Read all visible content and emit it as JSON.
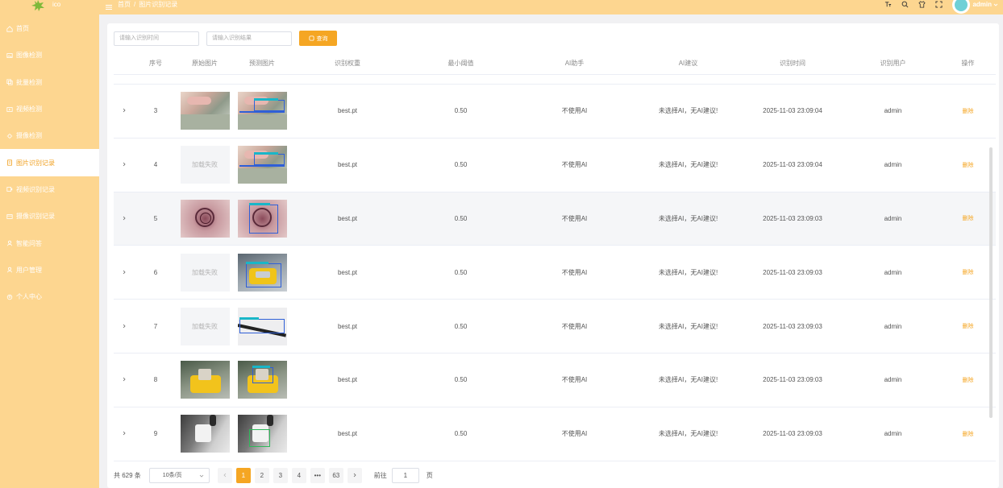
{
  "app": {
    "logo_text": "ico"
  },
  "sidebar": {
    "items": [
      {
        "label": "首页",
        "icon": "home-icon",
        "active": false
      },
      {
        "label": "图像检测",
        "icon": "image-icon",
        "active": false
      },
      {
        "label": "批量检测",
        "icon": "batch-icon",
        "active": false
      },
      {
        "label": "视频检测",
        "icon": "video-icon",
        "active": false
      },
      {
        "label": "摄像检测",
        "icon": "camera-icon",
        "active": false
      },
      {
        "label": "图片识别记录",
        "icon": "record-icon",
        "active": true
      },
      {
        "label": "视频识别记录",
        "icon": "video-record-icon",
        "active": false
      },
      {
        "label": "摄像识别记录",
        "icon": "camera-record-icon",
        "active": false
      },
      {
        "label": "智能问答",
        "icon": "chat-icon",
        "active": false
      },
      {
        "label": "用户管理",
        "icon": "user-manage-icon",
        "active": false
      },
      {
        "label": "个人中心",
        "icon": "profile-icon",
        "active": false
      }
    ]
  },
  "topbar": {
    "breadcrumb": [
      "首页",
      "/",
      "图片识别记录"
    ],
    "username": "admin"
  },
  "search": {
    "time_placeholder": "请输入识别时间",
    "result_placeholder": "请输入识别结果",
    "button_label": "查询"
  },
  "table": {
    "headers": {
      "no": "序号",
      "orig": "原始图片",
      "pred": "预测图片",
      "weight": "识别权重",
      "conf": "最小阈值",
      "ai": "AI助手",
      "sugg": "AI建议",
      "time": "识别时间",
      "user": "识别用户",
      "op": "操作"
    },
    "load_fail_text": "加载失败",
    "delete_label": "删除",
    "rows": [
      {
        "no": "3",
        "weight": "best.pt",
        "conf": "0.50",
        "ai": "不使用AI",
        "sugg": "未选择AI，无AI建议!",
        "time": "2025-11-03 23:09:04",
        "user": "admin"
      },
      {
        "no": "4",
        "weight": "best.pt",
        "conf": "0.50",
        "ai": "不使用AI",
        "sugg": "未选择AI，无AI建议!",
        "time": "2025-11-03 23:09:04",
        "user": "admin"
      },
      {
        "no": "5",
        "weight": "best.pt",
        "conf": "0.50",
        "ai": "不使用AI",
        "sugg": "未选择AI，无AI建议!",
        "time": "2025-11-03 23:09:03",
        "user": "admin"
      },
      {
        "no": "6",
        "weight": "best.pt",
        "conf": "0.50",
        "ai": "不使用AI",
        "sugg": "未选择AI，无AI建议!",
        "time": "2025-11-03 23:09:03",
        "user": "admin"
      },
      {
        "no": "7",
        "weight": "best.pt",
        "conf": "0.50",
        "ai": "不使用AI",
        "sugg": "未选择AI，无AI建议!",
        "time": "2025-11-03 23:09:03",
        "user": "admin"
      },
      {
        "no": "8",
        "weight": "best.pt",
        "conf": "0.50",
        "ai": "不使用AI",
        "sugg": "未选择AI，无AI建议!",
        "time": "2025-11-03 23:09:03",
        "user": "admin"
      },
      {
        "no": "9",
        "weight": "best.pt",
        "conf": "0.50",
        "ai": "不使用AI",
        "sugg": "未选择AI，无AI建议!",
        "time": "2025-11-03 23:09:03",
        "user": "admin"
      }
    ]
  },
  "pagination": {
    "total": "共 629 条",
    "page_size": "10条/页",
    "pages": [
      "1",
      "2",
      "3",
      "4",
      "•••",
      "63"
    ],
    "current": "1",
    "goto_label": "前往",
    "goto_value": "1",
    "page_suffix": "页"
  },
  "colors": {
    "sidebar_bg": "#fdd690",
    "accent": "#f5a623",
    "active_text": "#f0a020"
  }
}
